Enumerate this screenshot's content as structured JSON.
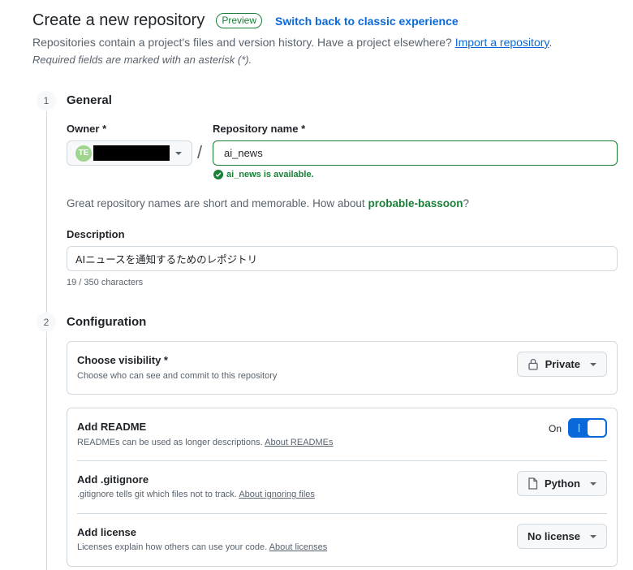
{
  "header": {
    "title": "Create a new repository",
    "badge": "Preview",
    "switch_link": "Switch back to classic experience"
  },
  "intro": {
    "subtitle": "Repositories contain a project's files and version history. Have a project elsewhere?",
    "import_link": "Import a repository",
    "required_note": "Required fields are marked with an asterisk (*)."
  },
  "steps": {
    "general": {
      "number": "1",
      "title": "General"
    },
    "configuration": {
      "number": "2",
      "title": "Configuration"
    }
  },
  "owner": {
    "label": "Owner *",
    "avatar_text": "TE"
  },
  "repo_name": {
    "label": "Repository name *",
    "value": "ai_news",
    "availability": "ai_news is available."
  },
  "suggestion": {
    "text": "Great repository names are short and memorable. How about",
    "name": "probable-bassoon",
    "suffix": "?"
  },
  "description": {
    "label": "Description",
    "value": "AIニュースを通知するためのレポジトリ",
    "char_count": "19 / 350 characters"
  },
  "visibility": {
    "title": "Choose visibility *",
    "desc": "Choose who can see and commit to this repository",
    "selected": "Private",
    "icon": "lock-icon"
  },
  "readme": {
    "title": "Add README",
    "desc": "READMEs can be used as longer descriptions.",
    "link": "About READMEs",
    "toggle_label": "On",
    "enabled": true
  },
  "gitignore": {
    "title": "Add .gitignore",
    "desc": ".gitignore tells git which files not to track.",
    "link": "About ignoring files",
    "selected": "Python",
    "icon": "file-icon"
  },
  "license": {
    "title": "Add license",
    "desc": "Licenses explain how others can use your code.",
    "link": "About licenses",
    "selected": "No license"
  },
  "colors": {
    "accent_blue": "#0969da",
    "success_green": "#1a7f37",
    "border": "#d1d9e0",
    "muted_text": "#59636e"
  }
}
